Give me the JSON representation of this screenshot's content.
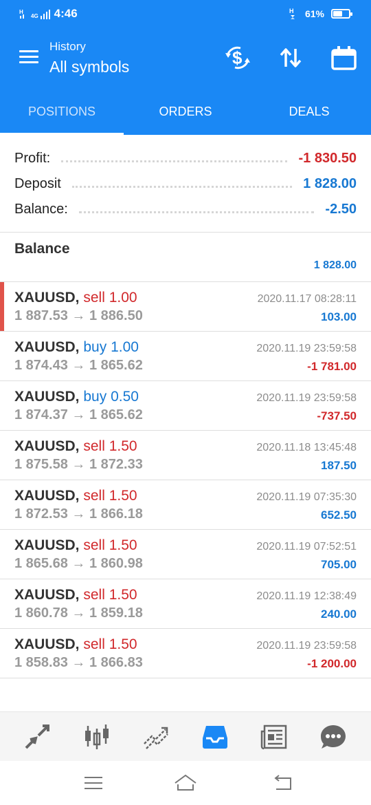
{
  "status_bar": {
    "time": "4:46",
    "network": "4G",
    "battery": "61%",
    "battery_level": 0.61
  },
  "header": {
    "subtitle": "History",
    "title": "All symbols",
    "actions": [
      "currency-exchange-icon",
      "sort-arrows-icon",
      "calendar-icon"
    ]
  },
  "tabs": [
    {
      "label": "POSITIONS",
      "active": true
    },
    {
      "label": "ORDERS",
      "active": false
    },
    {
      "label": "DEALS",
      "active": false
    }
  ],
  "summary": {
    "profit_label": "Profit:",
    "profit_value": "-1 830.50",
    "deposit_label": "Deposit",
    "deposit_value": "1 828.00",
    "balance_label": "Balance:",
    "balance_value": "-2.50"
  },
  "balance_entry": {
    "title": "Balance",
    "value": "1 828.00"
  },
  "deals": [
    {
      "symbol": "XAUUSD,",
      "type": "sell",
      "volume": "1.00",
      "open": "1 887.53",
      "close": "1 886.50",
      "time": "2020.11.17 08:28:11",
      "profit": "103.00",
      "profit_color": "blue"
    },
    {
      "symbol": "XAUUSD,",
      "type": "buy",
      "volume": "1.00",
      "open": "1 874.43",
      "close": "1 865.62",
      "time": "2020.11.19 23:59:58",
      "profit": "-1 781.00",
      "profit_color": "red"
    },
    {
      "symbol": "XAUUSD,",
      "type": "buy",
      "volume": "0.50",
      "open": "1 874.37",
      "close": "1 865.62",
      "time": "2020.11.19 23:59:58",
      "profit": "-737.50",
      "profit_color": "red"
    },
    {
      "symbol": "XAUUSD,",
      "type": "sell",
      "volume": "1.50",
      "open": "1 875.58",
      "close": "1 872.33",
      "time": "2020.11.18 13:45:48",
      "profit": "187.50",
      "profit_color": "blue"
    },
    {
      "symbol": "XAUUSD,",
      "type": "sell",
      "volume": "1.50",
      "open": "1 872.53",
      "close": "1 866.18",
      "time": "2020.11.19 07:35:30",
      "profit": "652.50",
      "profit_color": "blue"
    },
    {
      "symbol": "XAUUSD,",
      "type": "sell",
      "volume": "1.50",
      "open": "1 865.68",
      "close": "1 860.98",
      "time": "2020.11.19 07:52:51",
      "profit": "705.00",
      "profit_color": "blue"
    },
    {
      "symbol": "XAUUSD,",
      "type": "sell",
      "volume": "1.50",
      "open": "1 860.78",
      "close": "1 859.18",
      "time": "2020.11.19 12:38:49",
      "profit": "240.00",
      "profit_color": "blue"
    },
    {
      "symbol": "XAUUSD,",
      "type": "sell",
      "volume": "1.50",
      "open": "1 858.83",
      "close": "1 866.83",
      "time": "2020.11.19 23:59:58",
      "profit": "-1 200.00",
      "profit_color": "red"
    }
  ],
  "bottom_nav": [
    "quotes-icon",
    "chart-icon",
    "trade-icon",
    "history-icon",
    "news-icon",
    "chat-icon"
  ],
  "system_nav": [
    "menu-icon",
    "home-icon",
    "back-icon"
  ],
  "colors": {
    "primary": "#1a88f5",
    "profit_positive": "#1778d2",
    "profit_negative": "#d1282b",
    "selected_marker": "#e0534a"
  }
}
